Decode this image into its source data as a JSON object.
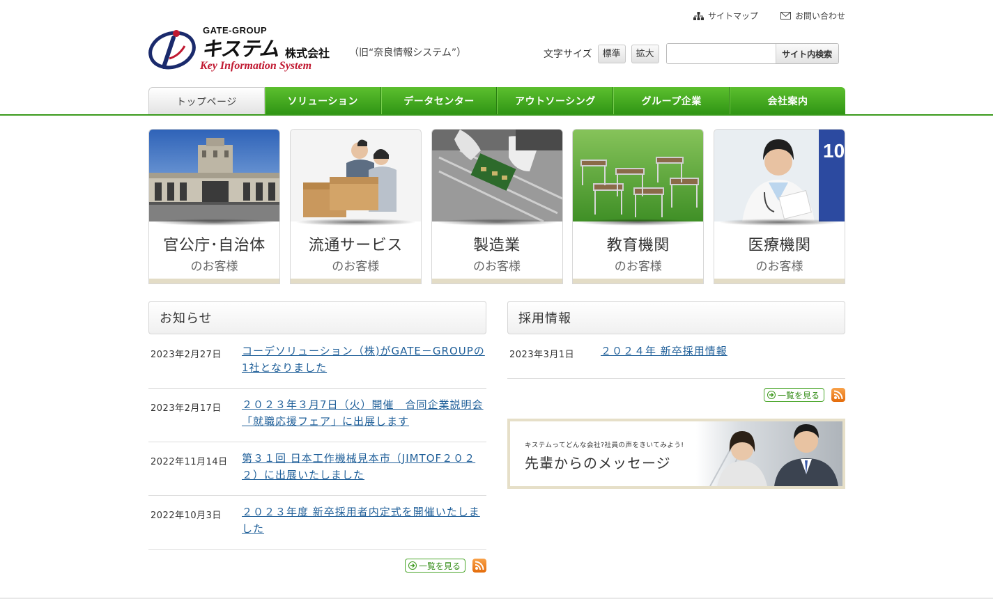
{
  "util_links": {
    "sitemap": "サイトマップ",
    "contact": "お問い合わせ"
  },
  "logo": {
    "group": "GATE-GROUP",
    "name": "キステム",
    "corp": "株式会社",
    "old_name": "（旧“奈良情報システム”）",
    "english": "Key Information System"
  },
  "tools": {
    "font_size_label": "文字サイズ",
    "normal": "標準",
    "large": "拡大",
    "search_value": "",
    "search_button": "サイト内検索"
  },
  "nav": [
    {
      "label": "トップページ"
    },
    {
      "label": "ソリューション"
    },
    {
      "label": "データセンター"
    },
    {
      "label": "アウトソーシング"
    },
    {
      "label": "グループ企業"
    },
    {
      "label": "会社案内"
    }
  ],
  "tiles": [
    {
      "title": "官公庁･自治体",
      "sub": "のお客様"
    },
    {
      "title": "流通サービス",
      "sub": "のお客様"
    },
    {
      "title": "製造業",
      "sub": "のお客様"
    },
    {
      "title": "教育機関",
      "sub": "のお客様"
    },
    {
      "title": "医療機関",
      "sub": "のお客様"
    }
  ],
  "news": {
    "heading": "お知らせ",
    "items": [
      {
        "date": "2023年2月27日",
        "text": "コーデソリューション（株)がGATE－GROUPの1社となりました"
      },
      {
        "date": "2023年2月17日",
        "text": "２０２３年３月7日（火）開催　合同企業説明会「就職応援フェア」に出展します"
      },
      {
        "date": "2022年11月14日",
        "text": "第３１回 日本工作機械見本市（JIMTOF２０２２）に出展いたしました"
      },
      {
        "date": "2022年10月3日",
        "text": "２０２３年度 新卒採用者内定式を開催いたしました"
      }
    ],
    "more": "一覧を見る"
  },
  "recruit": {
    "heading": "採用情報",
    "items": [
      {
        "date": "2023年3月1日",
        "text": "２０２４年 新卒採用情報"
      }
    ],
    "more": "一覧を見る"
  },
  "banner": {
    "small": "キステムってどんな会社?社員の声をきいてみよう!",
    "big": "先輩からのメッセージ"
  },
  "colors": {
    "nav_green": "#3fa51f",
    "link": "#1f5f99",
    "logo_red": "#c01830",
    "rss": "#f08a24"
  }
}
